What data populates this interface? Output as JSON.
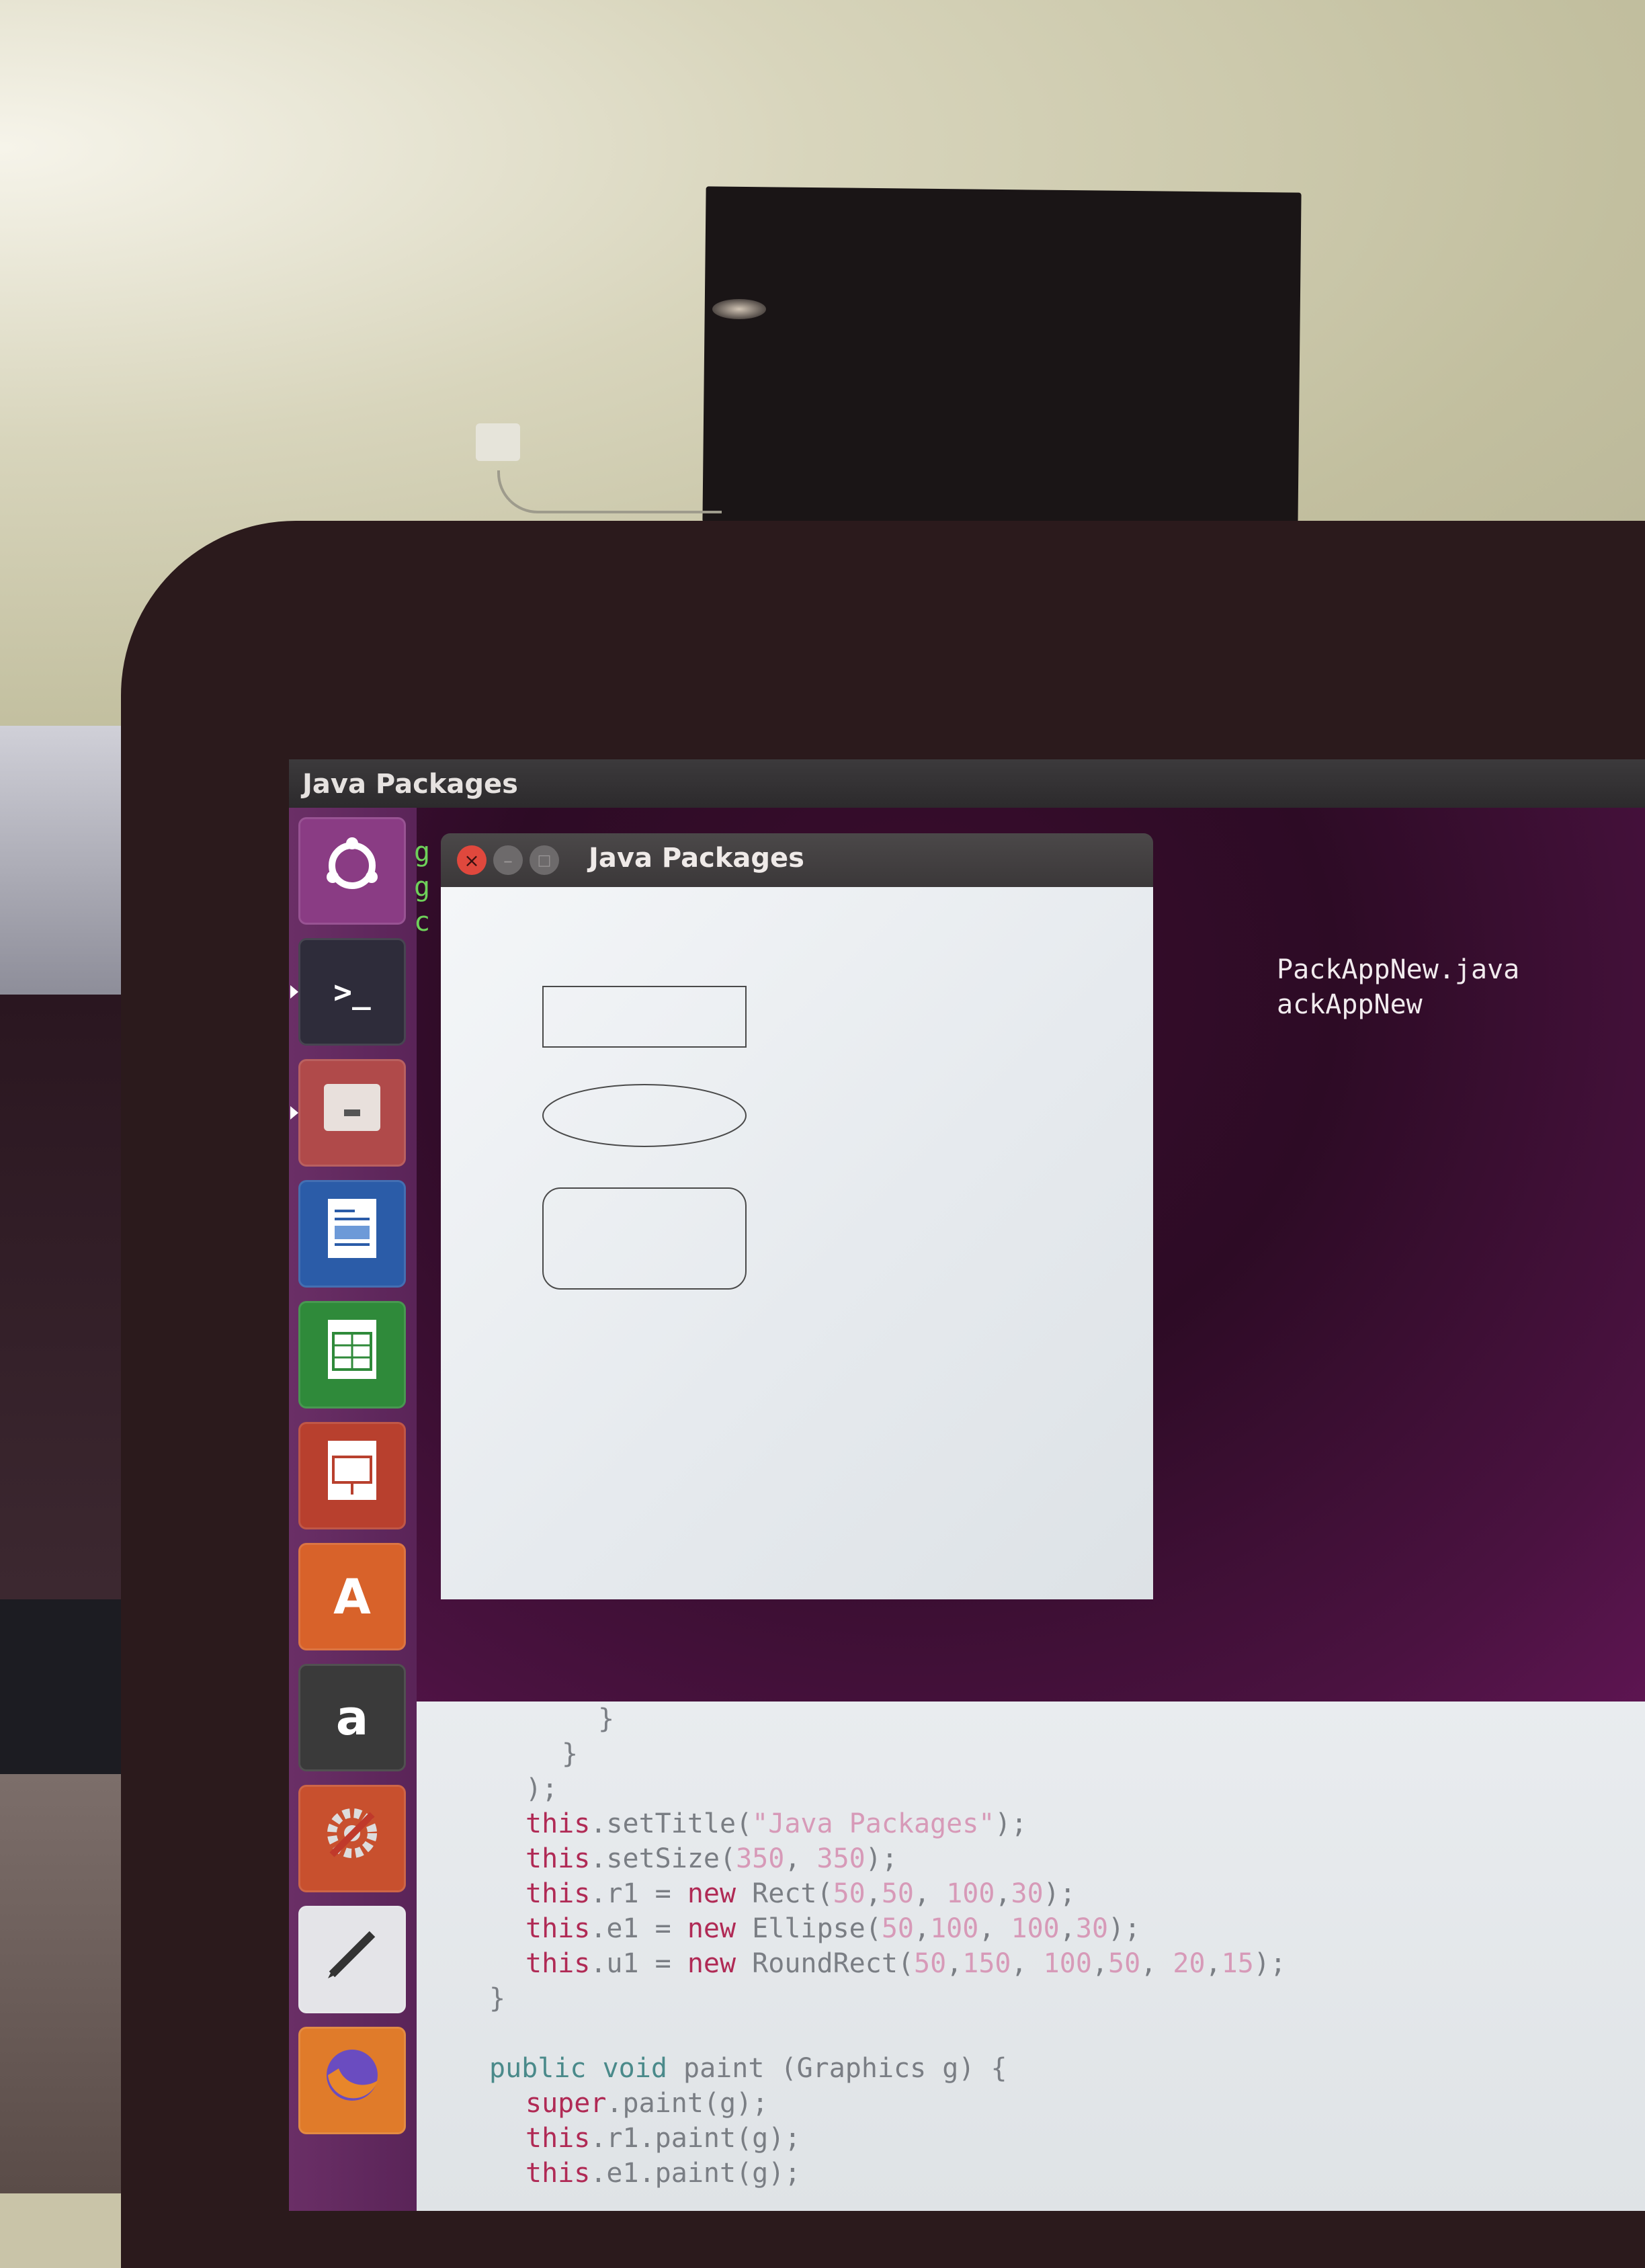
{
  "topbar": {
    "title": "Java Packages"
  },
  "launcher": {
    "items": [
      {
        "name": "ubuntu-dash",
        "icon": "ubuntu-logo-icon"
      },
      {
        "name": "terminal",
        "icon": "terminal-icon",
        "glyph": ">_"
      },
      {
        "name": "files",
        "icon": "file-cabinet-icon"
      },
      {
        "name": "writer",
        "icon": "document-icon"
      },
      {
        "name": "calc",
        "icon": "spreadsheet-icon"
      },
      {
        "name": "impress",
        "icon": "presentation-icon"
      },
      {
        "name": "software-center",
        "icon": "shopping-bag-icon",
        "glyph": "A"
      },
      {
        "name": "amazon",
        "icon": "amazon-icon",
        "glyph": "a"
      },
      {
        "name": "settings",
        "icon": "gear-wrench-icon"
      },
      {
        "name": "editor",
        "icon": "pen-icon"
      },
      {
        "name": "firefox",
        "icon": "firefox-icon"
      }
    ]
  },
  "terminal": {
    "lines": [
      "PackAppNew.java",
      "ackAppNew"
    ],
    "left_glyphs": [
      "g",
      "g",
      "c"
    ]
  },
  "java_window": {
    "title": "Java Packages",
    "buttons": {
      "close": "×",
      "minimize": "–",
      "maximize": "□"
    }
  },
  "code_lines": [
    {
      "indent": 10,
      "parts": [
        {
          "t": "}",
          "c": "plain"
        }
      ]
    },
    {
      "indent": 8,
      "parts": [
        {
          "t": "}",
          "c": "plain"
        }
      ]
    },
    {
      "indent": 6,
      "parts": [
        {
          "t": ");",
          "c": "plain"
        }
      ]
    },
    {
      "indent": 6,
      "parts": [
        {
          "t": "this",
          "c": "kw"
        },
        {
          "t": ".setTitle(",
          "c": "plain"
        },
        {
          "t": "\"Java Packages\"",
          "c": "str"
        },
        {
          "t": ");",
          "c": "plain"
        }
      ]
    },
    {
      "indent": 6,
      "parts": [
        {
          "t": "this",
          "c": "kw"
        },
        {
          "t": ".setSize(",
          "c": "plain"
        },
        {
          "t": "350",
          "c": "num"
        },
        {
          "t": ", ",
          "c": "plain"
        },
        {
          "t": "350",
          "c": "num"
        },
        {
          "t": ");",
          "c": "plain"
        }
      ]
    },
    {
      "indent": 6,
      "parts": [
        {
          "t": "this",
          "c": "kw"
        },
        {
          "t": ".r1 = ",
          "c": "plain"
        },
        {
          "t": "new",
          "c": "kw"
        },
        {
          "t": " Rect(",
          "c": "plain"
        },
        {
          "t": "50",
          "c": "num"
        },
        {
          "t": ",",
          "c": "plain"
        },
        {
          "t": "50",
          "c": "num"
        },
        {
          "t": ", ",
          "c": "plain"
        },
        {
          "t": "100",
          "c": "num"
        },
        {
          "t": ",",
          "c": "plain"
        },
        {
          "t": "30",
          "c": "num"
        },
        {
          "t": ");",
          "c": "plain"
        }
      ]
    },
    {
      "indent": 6,
      "parts": [
        {
          "t": "this",
          "c": "kw"
        },
        {
          "t": ".e1 = ",
          "c": "plain"
        },
        {
          "t": "new",
          "c": "kw"
        },
        {
          "t": " Ellipse(",
          "c": "plain"
        },
        {
          "t": "50",
          "c": "num"
        },
        {
          "t": ",",
          "c": "plain"
        },
        {
          "t": "100",
          "c": "num"
        },
        {
          "t": ", ",
          "c": "plain"
        },
        {
          "t": "100",
          "c": "num"
        },
        {
          "t": ",",
          "c": "plain"
        },
        {
          "t": "30",
          "c": "num"
        },
        {
          "t": ");",
          "c": "plain"
        }
      ]
    },
    {
      "indent": 6,
      "parts": [
        {
          "t": "this",
          "c": "kw"
        },
        {
          "t": ".u1 = ",
          "c": "plain"
        },
        {
          "t": "new",
          "c": "kw"
        },
        {
          "t": " RoundRect(",
          "c": "plain"
        },
        {
          "t": "50",
          "c": "num"
        },
        {
          "t": ",",
          "c": "plain"
        },
        {
          "t": "150",
          "c": "num"
        },
        {
          "t": ", ",
          "c": "plain"
        },
        {
          "t": "100",
          "c": "num"
        },
        {
          "t": ",",
          "c": "plain"
        },
        {
          "t": "50",
          "c": "num"
        },
        {
          "t": ", ",
          "c": "plain"
        },
        {
          "t": "20",
          "c": "num"
        },
        {
          "t": ",",
          "c": "plain"
        },
        {
          "t": "15",
          "c": "num"
        },
        {
          "t": ");",
          "c": "plain"
        }
      ]
    },
    {
      "indent": 4,
      "parts": [
        {
          "t": "}",
          "c": "plain"
        }
      ]
    },
    {
      "indent": 0,
      "parts": [
        {
          "t": "",
          "c": "plain"
        }
      ]
    },
    {
      "indent": 4,
      "parts": [
        {
          "t": "public void",
          "c": "typ"
        },
        {
          "t": " paint (Graphics g) {",
          "c": "plain"
        }
      ]
    },
    {
      "indent": 6,
      "parts": [
        {
          "t": "super",
          "c": "kw"
        },
        {
          "t": ".paint(g);",
          "c": "plain"
        }
      ]
    },
    {
      "indent": 6,
      "parts": [
        {
          "t": "this",
          "c": "kw"
        },
        {
          "t": ".r1.paint(g);",
          "c": "plain"
        }
      ]
    },
    {
      "indent": 6,
      "parts": [
        {
          "t": "this",
          "c": "kw"
        },
        {
          "t": ".e1.paint(g);",
          "c": "plain"
        }
      ]
    }
  ],
  "colors": {
    "terminal_bg": "#300a24",
    "launcher_bg": "#5e2750",
    "keyword": "#b02a55",
    "number": "#d79ab8",
    "close_button": "#e0483d"
  }
}
